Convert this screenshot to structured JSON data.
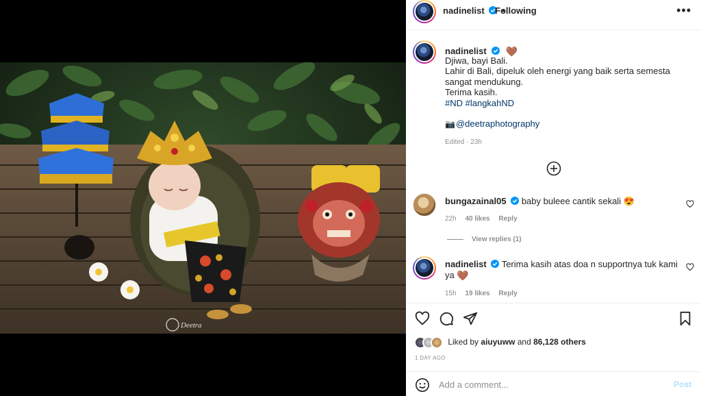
{
  "header": {
    "username": "nadinelist",
    "separator": "•",
    "follow_status": "Following",
    "more_icon": "more-icon"
  },
  "caption": {
    "username": "nadinelist",
    "emoji": "🤎",
    "lines": [
      "Djiwa, bayi Bali.",
      "Lahir di Bali, dipeluk oleh energi yang baik serta semesta sangat mendukung.",
      "Terima kasih."
    ],
    "hashtags": "#ND #langkahND",
    "camera_emoji": "📷",
    "photo_credit": "@deetraphotography",
    "edited": "Edited · 23h"
  },
  "comments": [
    {
      "username": "bungazainal05",
      "text": "baby buleee cantik sekali 😍",
      "time": "22h",
      "likes": "40 likes",
      "reply": "Reply",
      "view_replies": "View replies (1)"
    },
    {
      "username": "nadinelist",
      "text": "Terima kasih atas doa n supportnya tuk kami ya",
      "emoji": "🤎",
      "time": "15h",
      "likes": "19 likes",
      "reply": "Reply"
    }
  ],
  "likes": {
    "prefix": "Liked by",
    "user": "aiuyuww",
    "middle": "and",
    "count": "86,128 others"
  },
  "date": "1 DAY AGO",
  "add_comment": {
    "placeholder": "Add a comment...",
    "post_label": "Post"
  },
  "photo": {
    "watermark": "Deetra"
  },
  "colors": {
    "link": "#00376b",
    "verified": "#0095f6",
    "muted": "#8e8e8e",
    "post_disabled": "#b2dffc"
  }
}
